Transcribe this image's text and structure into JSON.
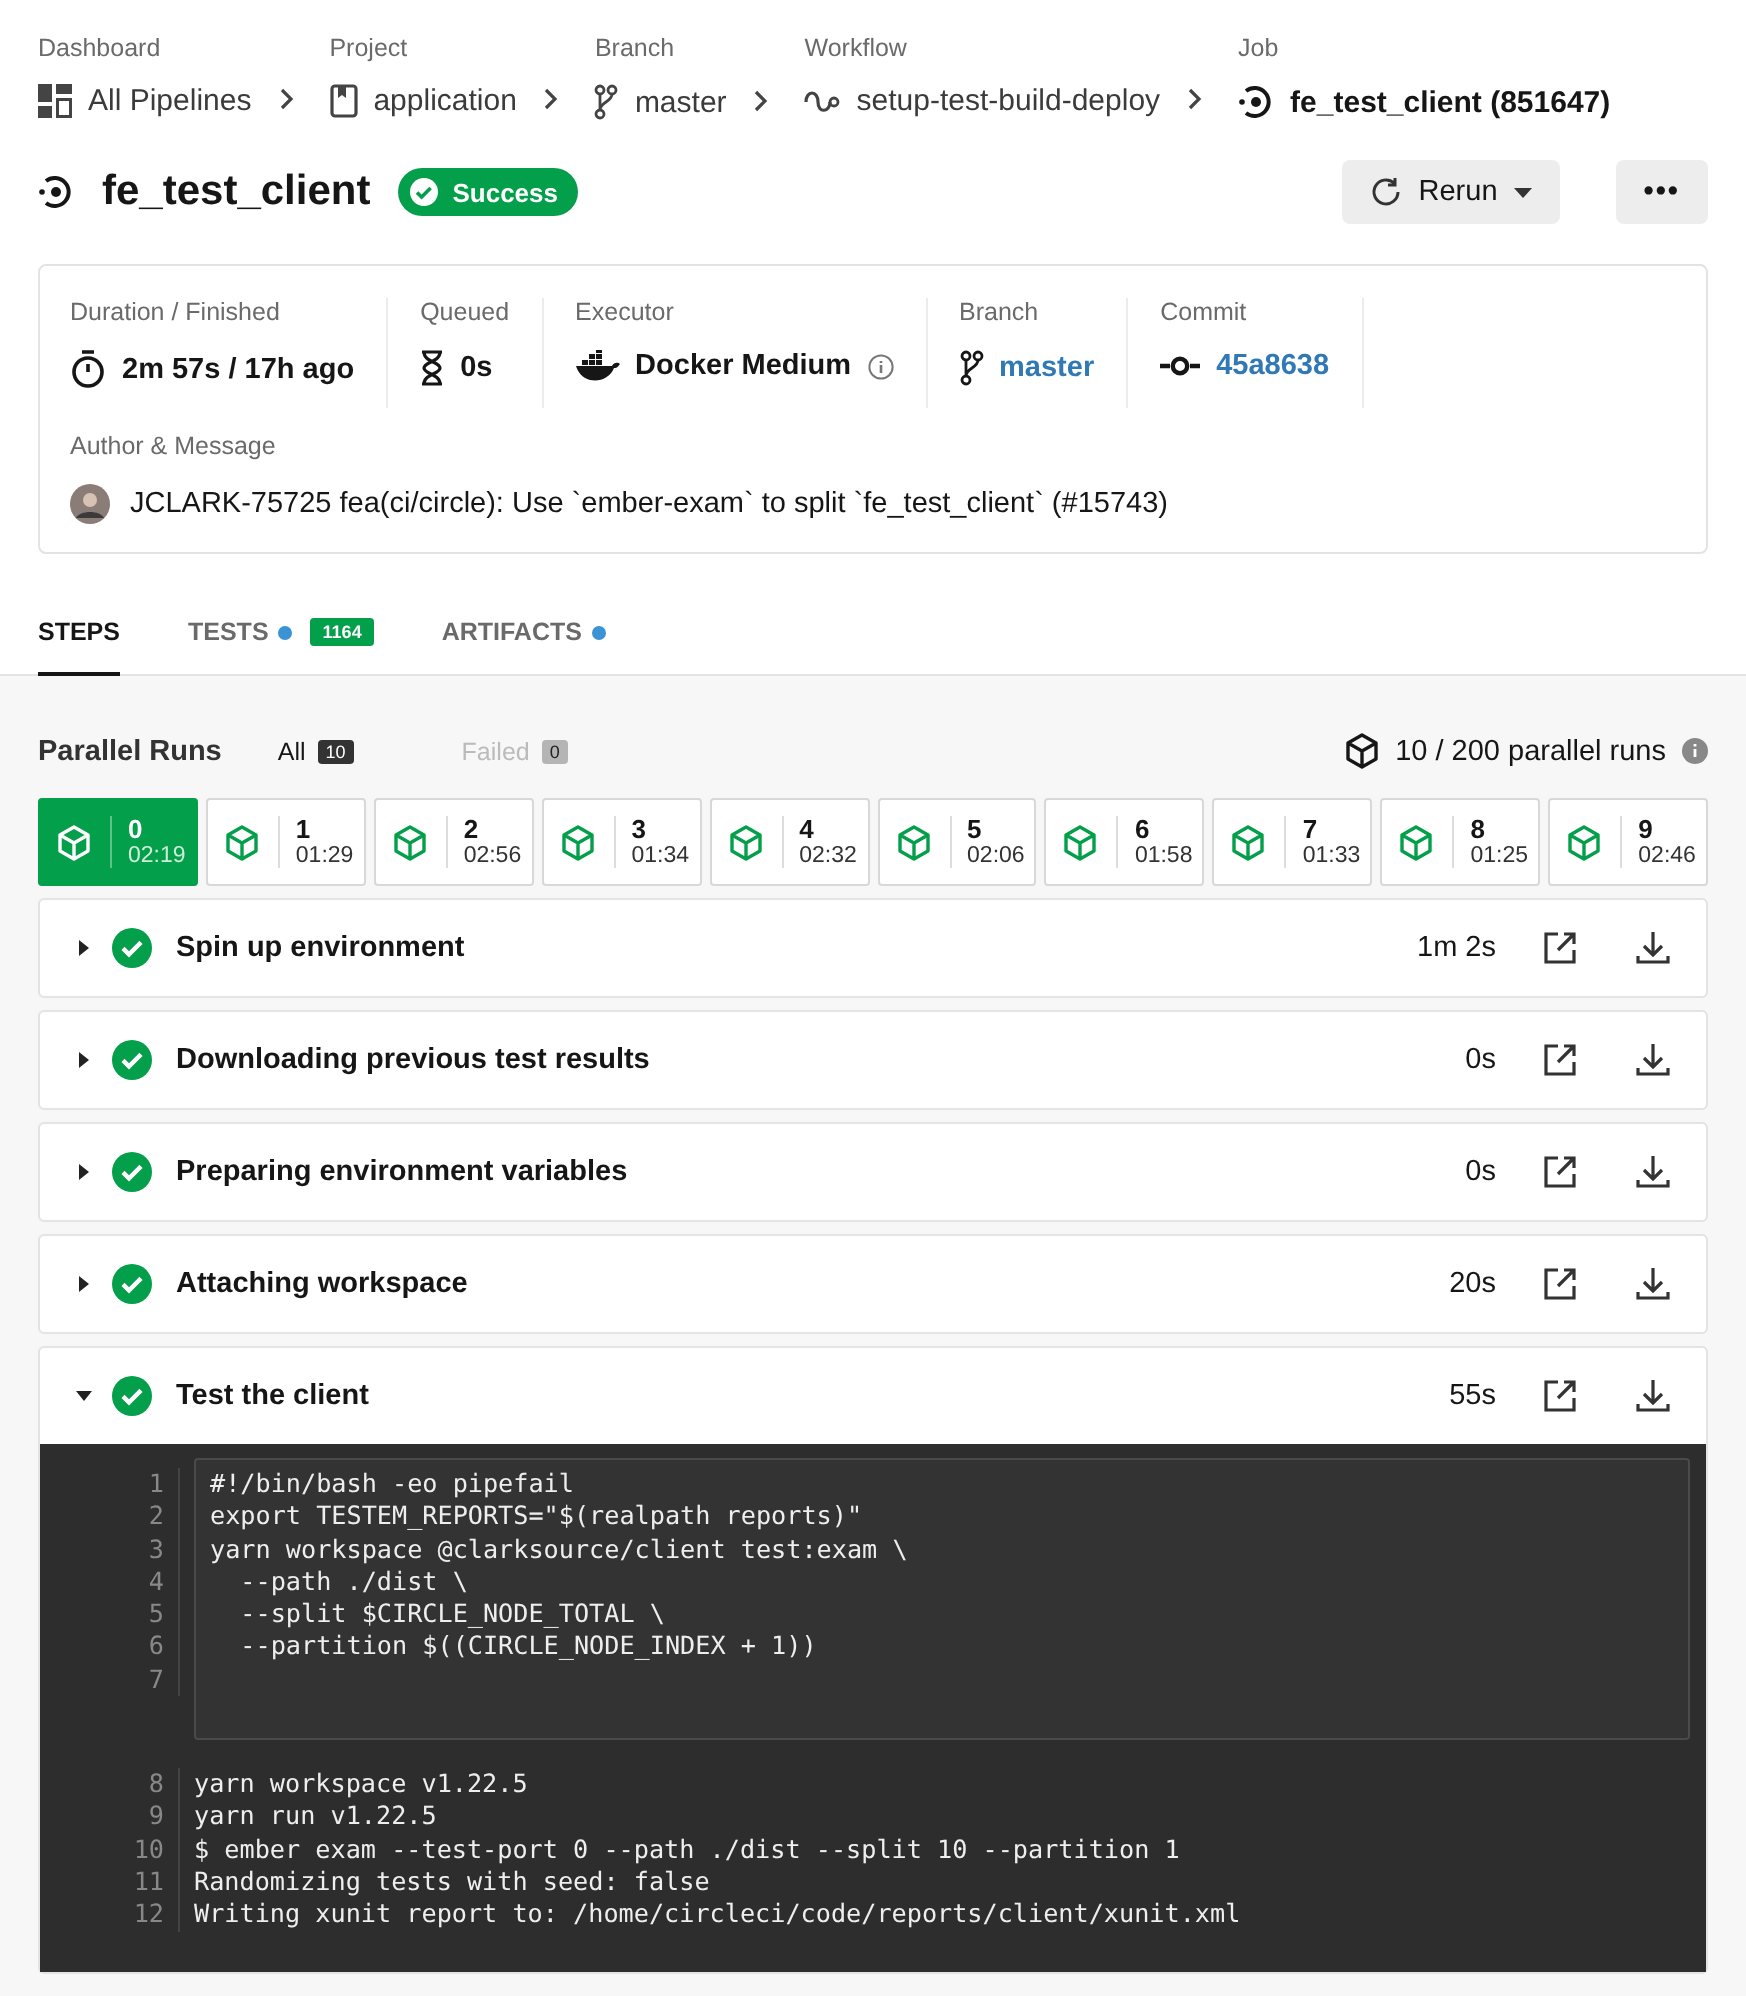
{
  "breadcrumbs": [
    {
      "label": "Dashboard",
      "value": "All Pipelines",
      "kind": "dashboard",
      "current": false
    },
    {
      "label": "Project",
      "value": "application",
      "kind": "project",
      "current": false
    },
    {
      "label": "Branch",
      "value": "master",
      "kind": "branch",
      "current": false
    },
    {
      "label": "Workflow",
      "value": "setup-test-build-deploy",
      "kind": "workflow",
      "current": false
    },
    {
      "label": "Job",
      "value": "fe_test_client (851647)",
      "kind": "job",
      "current": true
    }
  ],
  "job": {
    "title": "fe_test_client",
    "status": "Success",
    "rerun": "Rerun",
    "more": "•••"
  },
  "info": {
    "fields": [
      {
        "label": "Duration / Finished",
        "value": "2m 57s / 17h ago",
        "kind": "timer",
        "link": false,
        "info": false
      },
      {
        "label": "Queued",
        "value": "0s",
        "kind": "hourglass",
        "link": false,
        "info": false
      },
      {
        "label": "Executor",
        "value": "Docker Medium",
        "kind": "docker",
        "link": false,
        "info": true
      },
      {
        "label": "Branch",
        "value": "master",
        "kind": "branch",
        "link": true,
        "info": false
      },
      {
        "label": "Commit",
        "value": "45a8638",
        "kind": "commit",
        "link": true,
        "info": false
      }
    ],
    "author_label": "Author & Message",
    "message": "JCLARK-75725 fea(ci/circle): Use `ember-exam` to split `fe_test_client` (#15743)"
  },
  "tabs": [
    {
      "label": "STEPS",
      "selected": true,
      "dot": false
    },
    {
      "label": "TESTS",
      "selected": false,
      "dot": true,
      "badge": "1164"
    },
    {
      "label": "ARTIFACTS",
      "selected": false,
      "dot": true
    }
  ],
  "parallel": {
    "title": "Parallel Runs",
    "filters": [
      {
        "label": "All",
        "count": "10",
        "disabled": false
      },
      {
        "label": "Failed",
        "count": "0",
        "disabled": true
      }
    ],
    "summary": "10 / 200 parallel runs",
    "runs": [
      {
        "index": "0",
        "time": "02:19",
        "selected": true
      },
      {
        "index": "1",
        "time": "01:29",
        "selected": false
      },
      {
        "index": "2",
        "time": "02:56",
        "selected": false
      },
      {
        "index": "3",
        "time": "01:34",
        "selected": false
      },
      {
        "index": "4",
        "time": "02:32",
        "selected": false
      },
      {
        "index": "5",
        "time": "02:06",
        "selected": false
      },
      {
        "index": "6",
        "time": "01:58",
        "selected": false
      },
      {
        "index": "7",
        "time": "01:33",
        "selected": false
      },
      {
        "index": "8",
        "time": "01:25",
        "selected": false
      },
      {
        "index": "9",
        "time": "02:46",
        "selected": false
      }
    ]
  },
  "steps": [
    {
      "name": "Spin up environment",
      "duration": "1m 2s",
      "expanded": false
    },
    {
      "name": "Downloading previous test results",
      "duration": "0s",
      "expanded": false
    },
    {
      "name": "Preparing environment variables",
      "duration": "0s",
      "expanded": false
    },
    {
      "name": "Attaching workspace",
      "duration": "20s",
      "expanded": false
    },
    {
      "name": "Test the client",
      "duration": "55s",
      "expanded": true
    }
  ],
  "log": {
    "command": [
      {
        "number": "1",
        "text": "#!/bin/bash -eo pipefail"
      },
      {
        "number": "2",
        "text": "export TESTEM_REPORTS=\"$(realpath reports)\""
      },
      {
        "number": "3",
        "text": "yarn workspace @clarksource/client test:exam \\"
      },
      {
        "number": "4",
        "text": "  --path ./dist \\"
      },
      {
        "number": "5",
        "text": "  --split $CIRCLE_NODE_TOTAL \\"
      },
      {
        "number": "6",
        "text": "  --partition $((CIRCLE_NODE_INDEX + 1))"
      },
      {
        "number": "7"
      }
    ],
    "output": [
      {
        "number": "8",
        "text": "yarn workspace v1.22.5"
      },
      {
        "number": "9",
        "text": "yarn run v1.22.5"
      },
      {
        "number": "10",
        "text": "$ ember exam --test-port 0 --path ./dist --split 10 --partition 1"
      },
      {
        "number": "11",
        "text": "Randomizing tests with seed: false"
      },
      {
        "number": "12",
        "text": "Writing xunit report to: /home/circleci/code/reports/client/xunit.xml"
      }
    ]
  }
}
